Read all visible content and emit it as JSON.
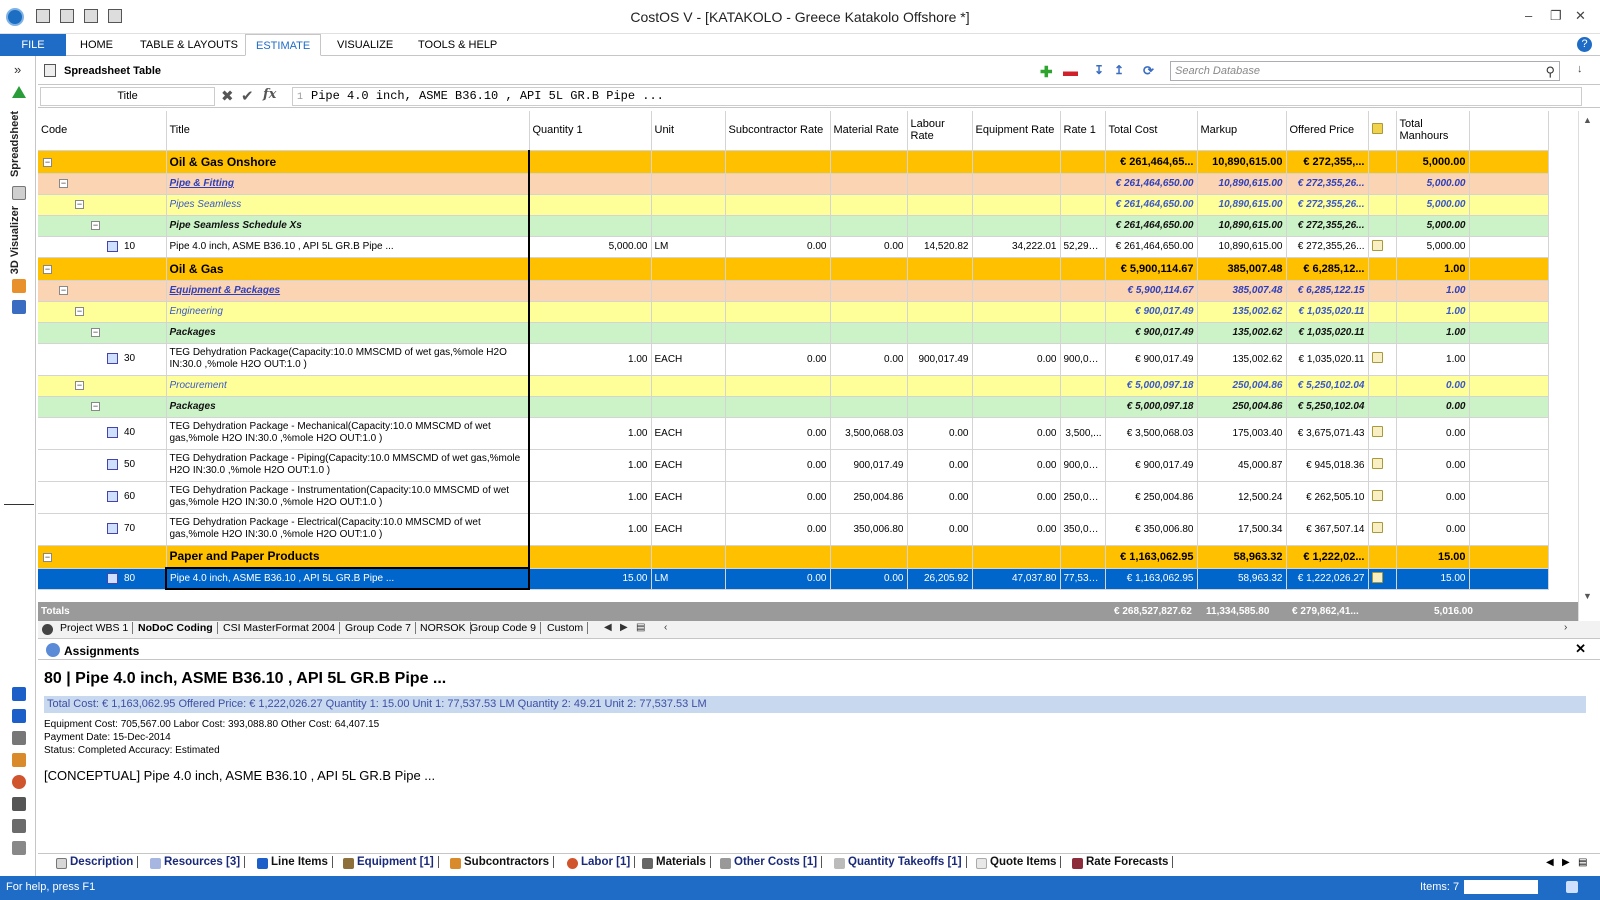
{
  "window": {
    "title": "CostOS V - [KATAKOLO - Greece Katakolo Offshore *]"
  },
  "ribbon": {
    "tabs": [
      "FILE",
      "HOME",
      "TABLE & LAYOUTS",
      "ESTIMATE",
      "VISUALIZE",
      "TOOLS & HELP"
    ],
    "active": "ESTIMATE"
  },
  "left_panel": {
    "labels": [
      "Spreadsheet",
      "3D Visualizer"
    ]
  },
  "toolbar": {
    "title": "Spreadsheet Table",
    "search_placeholder": "Search Database"
  },
  "formula": {
    "name": "Title",
    "index": "1",
    "value": "Pipe 4.0 inch, ASME B36.10 , API 5L GR.B Pipe ..."
  },
  "columns": [
    "Code",
    "Title",
    "Quantity 1",
    "Unit",
    "Subcontractor Rate",
    "Material Rate",
    "Labour Rate",
    "Equipment Rate",
    "Rate 1",
    "Total Cost",
    "Markup",
    "Offered Price",
    "",
    "Total Manhours"
  ],
  "rows": [
    {
      "level": "l0",
      "code": "",
      "title": "Oil & Gas Onshore",
      "qty": "",
      "unit": "",
      "sub": "",
      "mat": "",
      "lab": "",
      "eq": "",
      "rate": "",
      "total": "€ 261,464,65...",
      "markup": "10,890,615.00",
      "offered": "€ 272,355,...",
      "manhours": "5,000.00"
    },
    {
      "level": "l1",
      "code": "",
      "title": "Pipe & Fitting",
      "qty": "",
      "unit": "",
      "sub": "",
      "mat": "",
      "lab": "",
      "eq": "",
      "rate": "",
      "total": "€ 261,464,650.00",
      "markup": "10,890,615.00",
      "offered": "€ 272,355,26...",
      "manhours": "5,000.00"
    },
    {
      "level": "l2",
      "code": "",
      "title": "Pipes Seamless",
      "qty": "",
      "unit": "",
      "sub": "",
      "mat": "",
      "lab": "",
      "eq": "",
      "rate": "",
      "total": "€ 261,464,650.00",
      "markup": "10,890,615.00",
      "offered": "€ 272,355,26...",
      "manhours": "5,000.00"
    },
    {
      "level": "l3",
      "code": "",
      "title": "Pipe Seamless Schedule Xs",
      "qty": "",
      "unit": "",
      "sub": "",
      "mat": "",
      "lab": "",
      "eq": "",
      "rate": "",
      "total": "€ 261,464,650.00",
      "markup": "10,890,615.00",
      "offered": "€ 272,355,26...",
      "manhours": "5,000.00"
    },
    {
      "level": "item",
      "code": "10",
      "title": "Pipe 4.0 inch, ASME B36.10 , API 5L GR.B Pipe ...",
      "qty": "5,000.00",
      "unit": "LM",
      "sub": "0.00",
      "mat": "0.00",
      "lab": "14,520.82",
      "eq": "34,222.01",
      "rate": "52,292...",
      "total": "€ 261,464,650.00",
      "markup": "10,890,615.00",
      "offered": "€ 272,355,26...",
      "manhours": "5,000.00"
    },
    {
      "level": "l0",
      "code": "",
      "title": "Oil & Gas",
      "qty": "",
      "unit": "",
      "sub": "",
      "mat": "",
      "lab": "",
      "eq": "",
      "rate": "",
      "total": "€ 5,900,114.67",
      "markup": "385,007.48",
      "offered": "€ 6,285,12...",
      "manhours": "1.00"
    },
    {
      "level": "l1",
      "code": "",
      "title": "Equipment & Packages",
      "qty": "",
      "unit": "",
      "sub": "",
      "mat": "",
      "lab": "",
      "eq": "",
      "rate": "",
      "total": "€ 5,900,114.67",
      "markup": "385,007.48",
      "offered": "€ 6,285,122.15",
      "manhours": "1.00"
    },
    {
      "level": "l2",
      "code": "",
      "title": "Engineering",
      "qty": "",
      "unit": "",
      "sub": "",
      "mat": "",
      "lab": "",
      "eq": "",
      "rate": "",
      "total": "€ 900,017.49",
      "markup": "135,002.62",
      "offered": "€ 1,035,020.11",
      "manhours": "1.00"
    },
    {
      "level": "l3",
      "code": "",
      "title": "Packages",
      "qty": "",
      "unit": "",
      "sub": "",
      "mat": "",
      "lab": "",
      "eq": "",
      "rate": "",
      "total": "€ 900,017.49",
      "markup": "135,002.62",
      "offered": "€ 1,035,020.11",
      "manhours": "1.00"
    },
    {
      "level": "item tall",
      "code": "30",
      "title": "TEG Dehydration Package(Capacity:10.0 MMSCMD of wet gas,%mole H2O IN:30.0 ,%mole H2O OUT:1.0 )",
      "qty": "1.00",
      "unit": "EACH",
      "sub": "0.00",
      "mat": "0.00",
      "lab": "900,017.49",
      "eq": "0.00",
      "rate": "900,01...",
      "total": "€ 900,017.49",
      "markup": "135,002.62",
      "offered": "€ 1,035,020.11",
      "manhours": "1.00"
    },
    {
      "level": "l2",
      "code": "",
      "title": "Procurement",
      "qty": "",
      "unit": "",
      "sub": "",
      "mat": "",
      "lab": "",
      "eq": "",
      "rate": "",
      "total": "€ 5,000,097.18",
      "markup": "250,004.86",
      "offered": "€ 5,250,102.04",
      "manhours": "0.00"
    },
    {
      "level": "l3",
      "code": "",
      "title": "Packages",
      "qty": "",
      "unit": "",
      "sub": "",
      "mat": "",
      "lab": "",
      "eq": "",
      "rate": "",
      "total": "€ 5,000,097.18",
      "markup": "250,004.86",
      "offered": "€ 5,250,102.04",
      "manhours": "0.00"
    },
    {
      "level": "item tall",
      "code": "40",
      "title": "TEG Dehydration Package - Mechanical(Capacity:10.0 MMSCMD of wet gas,%mole H2O IN:30.0 ,%mole H2O OUT:1.0 )",
      "qty": "1.00",
      "unit": "EACH",
      "sub": "0.00",
      "mat": "3,500,068.03",
      "lab": "0.00",
      "eq": "0.00",
      "rate": "3,500,...",
      "total": "€ 3,500,068.03",
      "markup": "175,003.40",
      "offered": "€ 3,675,071.43",
      "manhours": "0.00"
    },
    {
      "level": "item tall",
      "code": "50",
      "title": "TEG Dehydration Package - Piping(Capacity:10.0 MMSCMD of wet gas,%mole H2O IN:30.0 ,%mole H2O OUT:1.0 )",
      "qty": "1.00",
      "unit": "EACH",
      "sub": "0.00",
      "mat": "900,017.49",
      "lab": "0.00",
      "eq": "0.00",
      "rate": "900,01...",
      "total": "€ 900,017.49",
      "markup": "45,000.87",
      "offered": "€ 945,018.36",
      "manhours": "0.00"
    },
    {
      "level": "item tall",
      "code": "60",
      "title": "TEG Dehydration Package - Instrumentation(Capacity:10.0 MMSCMD of wet gas,%mole H2O IN:30.0 ,%mole H2O OUT:1.0 )",
      "qty": "1.00",
      "unit": "EACH",
      "sub": "0.00",
      "mat": "250,004.86",
      "lab": "0.00",
      "eq": "0.00",
      "rate": "250,00...",
      "total": "€ 250,004.86",
      "markup": "12,500.24",
      "offered": "€ 262,505.10",
      "manhours": "0.00"
    },
    {
      "level": "item tall",
      "code": "70",
      "title": "TEG Dehydration Package - Electrical(Capacity:10.0 MMSCMD of wet gas,%mole H2O IN:30.0 ,%mole H2O OUT:1.0 )",
      "qty": "1.00",
      "unit": "EACH",
      "sub": "0.00",
      "mat": "350,006.80",
      "lab": "0.00",
      "eq": "0.00",
      "rate": "350,00...",
      "total": "€ 350,006.80",
      "markup": "17,500.34",
      "offered": "€ 367,507.14",
      "manhours": "0.00"
    },
    {
      "level": "l0",
      "code": "",
      "title": "Paper and Paper Products",
      "qty": "",
      "unit": "",
      "sub": "",
      "mat": "",
      "lab": "",
      "eq": "",
      "rate": "",
      "total": "€ 1,163,062.95",
      "markup": "58,963.32",
      "offered": "€ 1,222,02...",
      "manhours": "15.00"
    },
    {
      "level": "item sel",
      "code": "80",
      "title": "Pipe 4.0 inch, ASME B36.10 , API 5L GR.B Pipe ...",
      "qty": "15.00",
      "unit": "LM",
      "sub": "0.00",
      "mat": "0.00",
      "lab": "26,205.92",
      "eq": "47,037.80",
      "rate": "77,537...",
      "total": "€ 1,163,062.95",
      "markup": "58,963.32",
      "offered": "€ 1,222,026.27",
      "manhours": "15.00"
    }
  ],
  "totals": {
    "label": "Totals",
    "total": "€ 268,527,827.62",
    "markup": "11,334,585.80",
    "offered": "€ 279,862,41...",
    "manhours": "5,016.00"
  },
  "sheet_tabs": [
    "Project WBS 1",
    "NoDoC Coding",
    "CSI MasterFormat 2004",
    "Group Code 7",
    "NORSOK",
    "Group Code 9",
    "Custom"
  ],
  "assignments": {
    "label": "Assignments"
  },
  "detail": {
    "heading": "80 | Pipe 4.0 inch, ASME B36.10 , API 5L GR.B Pipe ...",
    "summary": "Total Cost: € 1,163,062.95 Offered Price: € 1,222,026.27 Quantity 1: 15.00 Unit 1: 77,537.53 LM Quantity 2: 49.21 Unit 2: 77,537.53 LM",
    "line1": "Equipment Cost: 705,567.00 Labor Cost: 393,088.80 Other Cost: 64,407.15",
    "line2": "Payment Date: 15-Dec-2014",
    "line3": "Status: Completed Accuracy: Estimated",
    "conceptual": "[CONCEPTUAL] Pipe 4.0 inch, ASME B36.10 , API 5L GR.B Pipe ..."
  },
  "bottom_tabs": [
    "Description",
    "Resources [3]",
    "Line Items",
    "Equipment [1]",
    "Subcontractors",
    "Labor [1]",
    "Materials",
    "Other Costs [1]",
    "Quantity Takeoffs [1]",
    "Quote Items",
    "Rate Forecasts"
  ],
  "status": {
    "help": "For help, press F1",
    "items": "Items: 7"
  }
}
